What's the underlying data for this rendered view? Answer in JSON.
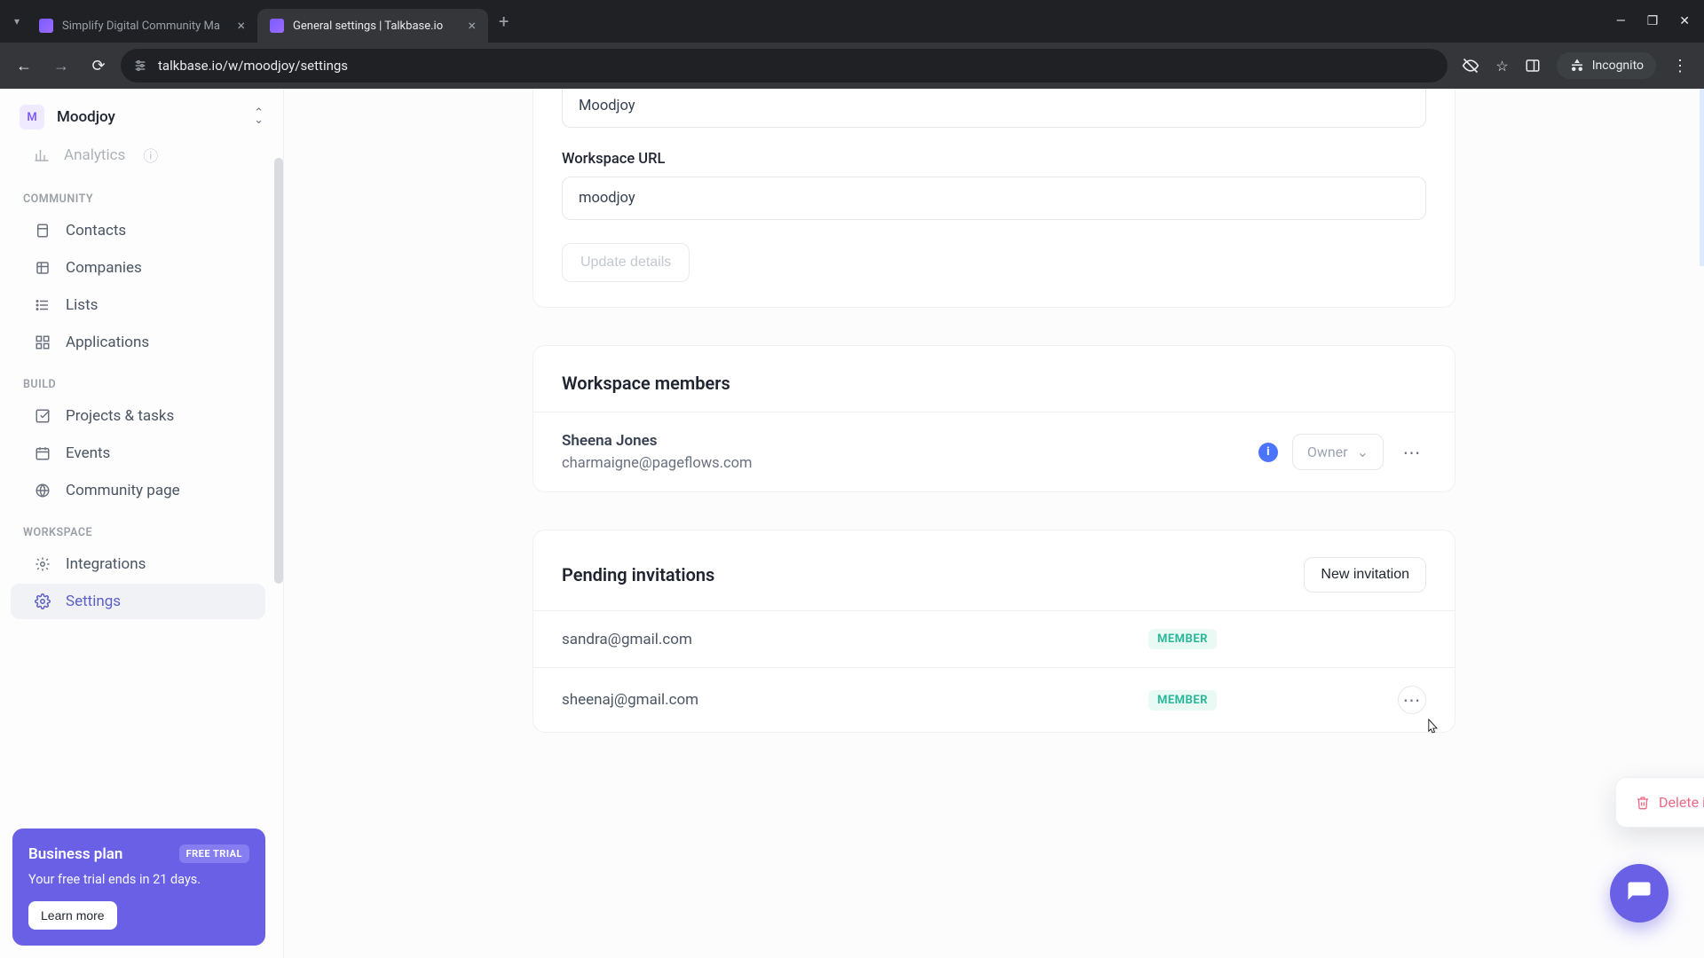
{
  "browser": {
    "tabs": [
      {
        "title": "Simplify Digital Community Ma"
      },
      {
        "title": "General settings | Talkbase.io"
      }
    ],
    "url": "talkbase.io/w/moodjoy/settings",
    "incognito_label": "Incognito"
  },
  "workspace_switcher": {
    "initial": "M",
    "name": "Moodjoy"
  },
  "sidebar": {
    "partial_item": "Analytics",
    "sections": [
      {
        "label": "COMMUNITY",
        "items": [
          {
            "id": "contacts",
            "label": "Contacts"
          },
          {
            "id": "companies",
            "label": "Companies"
          },
          {
            "id": "lists",
            "label": "Lists"
          },
          {
            "id": "applications",
            "label": "Applications"
          }
        ]
      },
      {
        "label": "BUILD",
        "items": [
          {
            "id": "projects",
            "label": "Projects & tasks"
          },
          {
            "id": "events",
            "label": "Events"
          },
          {
            "id": "community-page",
            "label": "Community page"
          }
        ]
      },
      {
        "label": "WORKSPACE",
        "items": [
          {
            "id": "integrations",
            "label": "Integrations"
          },
          {
            "id": "settings",
            "label": "Settings"
          }
        ]
      }
    ]
  },
  "promo": {
    "title": "Business plan",
    "badge": "FREE TRIAL",
    "subtitle": "Your free trial ends in 21 days.",
    "cta": "Learn more"
  },
  "settings": {
    "name_value": "Moodjoy",
    "url_label": "Workspace URL",
    "url_value": "moodjoy",
    "update_btn": "Update details"
  },
  "members": {
    "title": "Workspace members",
    "list": [
      {
        "name": "Sheena Jones",
        "email": "charmaigne@pageflows.com",
        "role": "Owner"
      }
    ]
  },
  "pending": {
    "title": "Pending invitations",
    "new_btn": "New invitation",
    "list": [
      {
        "email": "sandra@gmail.com",
        "role": "MEMBER"
      },
      {
        "email": "sheenaj@gmail.com",
        "role": "MEMBER"
      }
    ]
  },
  "popover": {
    "delete_label": "Delete invitation"
  }
}
